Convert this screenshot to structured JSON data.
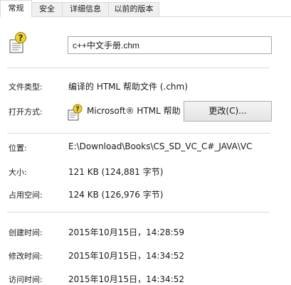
{
  "tabs": [
    {
      "label": "常规",
      "active": true
    },
    {
      "label": "安全",
      "active": false
    },
    {
      "label": "详细信息",
      "active": false
    },
    {
      "label": "以前的版本",
      "active": false
    }
  ],
  "file": {
    "icon": "chm-help-file-icon",
    "name": "c++中文手册.chm"
  },
  "type": {
    "label": "文件类型:",
    "value": "编译的 HTML 帮助文件 (.chm)"
  },
  "opens_with": {
    "label": "打开方式:",
    "app_icon": "chm-help-file-icon",
    "app_name": "Microsoft® HTML 帮助",
    "change_button": "更改(C)..."
  },
  "location": {
    "label": "位置:",
    "value": "E:\\Download\\Books\\CS_SD_VC_C#_JAVA\\VC"
  },
  "size": {
    "label": "大小:",
    "value": "121 KB (124,881 字节)"
  },
  "size_on_disk": {
    "label": "占用空间:",
    "value": "124 KB (126,976 字节)"
  },
  "created": {
    "label": "创建时间:",
    "value": "2015年10月15日，14:28:59"
  },
  "modified": {
    "label": "修改时间:",
    "value": "2015年10月15日，14:34:52"
  },
  "accessed": {
    "label": "访问时间:",
    "value": "2015年10月15日，14:34:52"
  },
  "colors": {
    "border": "#d9d9d9",
    "separator": "#dcdcdc",
    "icon_yellow": "#f2d22e"
  }
}
